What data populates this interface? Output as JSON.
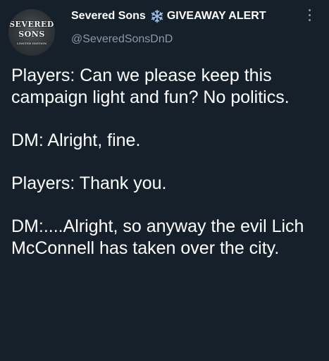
{
  "tweet": {
    "author": {
      "display_name": "Severed Sons",
      "badge_icon": "snowflake-icon",
      "name_suffix": "GIVEAWAY ALERT",
      "handle": "@SeveredSonsDnD",
      "avatar": {
        "line1": "SEVERED",
        "line2": "SONS",
        "line3": "LIMITED EDITION"
      }
    },
    "paragraphs": [
      "Players: Can we please keep this campaign light and fun? No politics.",
      "DM: Alright, fine.",
      "Players: Thank you.",
      "DM:....Alright, so anyway the evil Lich McConnell has taken over the city."
    ]
  },
  "colors": {
    "background": "#15202b",
    "text_primary": "#ffffff",
    "text_secondary": "#8b98a5",
    "snowflake": "#9fc3ee"
  }
}
